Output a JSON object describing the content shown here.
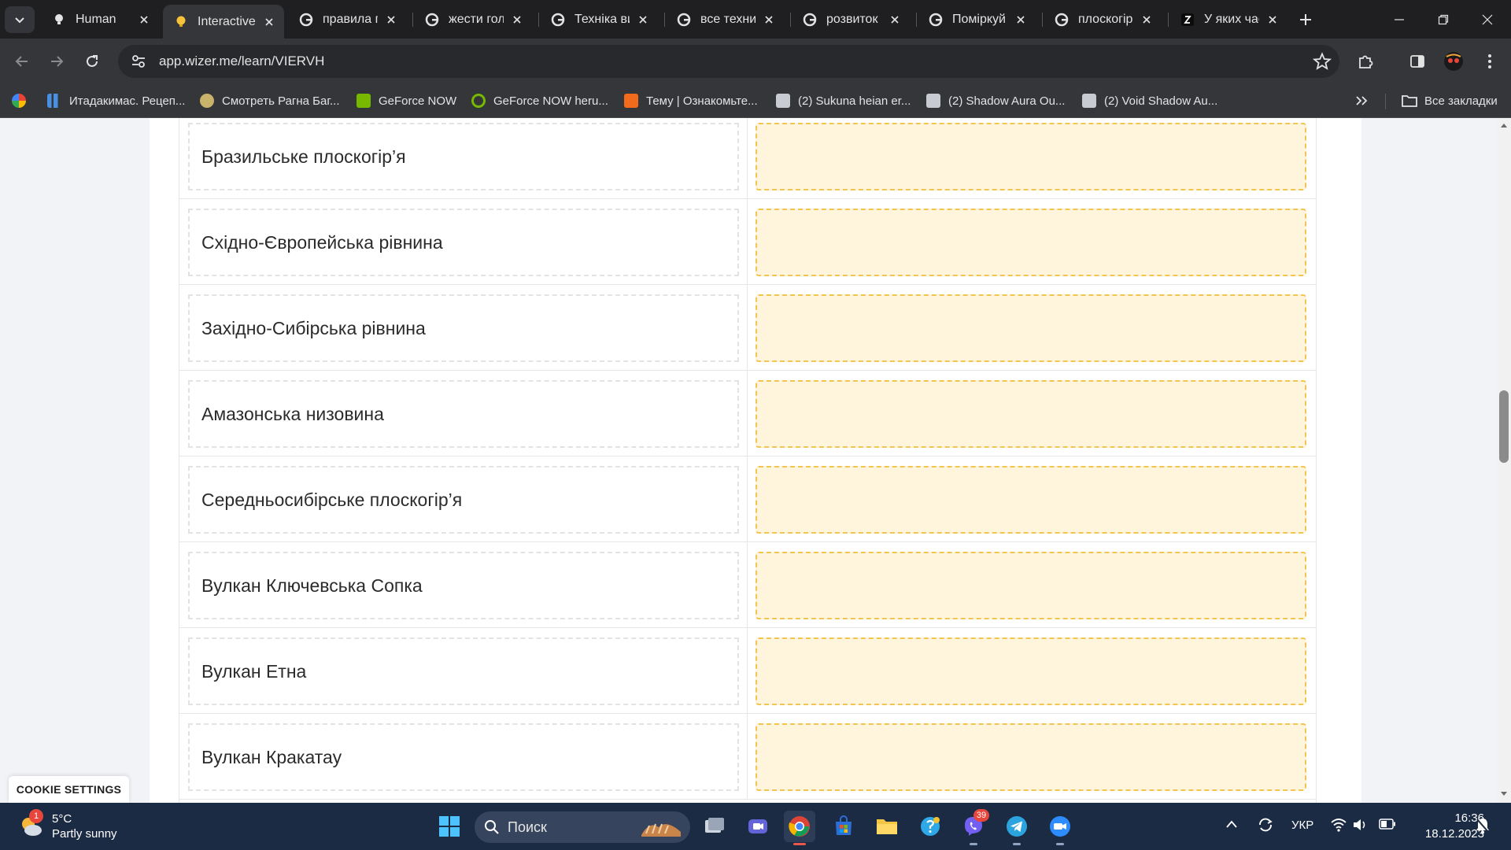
{
  "browser": {
    "tabs": [
      {
        "title": "Human",
        "active": false
      },
      {
        "title": "Interactive",
        "active": true
      },
      {
        "title": "правила г",
        "active": false
      },
      {
        "title": "жести гол",
        "active": false
      },
      {
        "title": "Техніка ви",
        "active": false
      },
      {
        "title": "все техни",
        "active": false
      },
      {
        "title": "розвиток",
        "active": false
      },
      {
        "title": "Поміркуй",
        "active": false
      },
      {
        "title": "плоскогір",
        "active": false
      },
      {
        "title": "У яких час",
        "active": false
      }
    ],
    "url": "app.wizer.me/learn/VIERVH",
    "bookmarks": [
      {
        "label": "Итадакимас. Рецеп..."
      },
      {
        "label": "Смотреть Рагна Баг..."
      },
      {
        "label": "GeForce NOW"
      },
      {
        "label": "GeForce NOW heru..."
      },
      {
        "label": "Тему | Ознакомьте..."
      },
      {
        "label": "(2) Sukuna heian er..."
      },
      {
        "label": "(2) Shadow Aura Ou..."
      },
      {
        "label": "(2) Void Shadow Au..."
      }
    ],
    "all_bookmarks": "Все закладки"
  },
  "matching": {
    "rows": [
      {
        "left": "Бразильське плоскогір’я",
        "right": ""
      },
      {
        "left": "Східно-Європейська рівнина",
        "right": ""
      },
      {
        "left": "Західно-Сибірська рівнина",
        "right": ""
      },
      {
        "left": "Амазонська низовина",
        "right": ""
      },
      {
        "left": "Середньосибірське плоскогір’я",
        "right": ""
      },
      {
        "left": "Вулкан Ключевська Сопка",
        "right": ""
      },
      {
        "left": "Вулкан Етна",
        "right": ""
      },
      {
        "left": "Вулкан Кракатау",
        "right": ""
      }
    ]
  },
  "cookie": {
    "label": "COOKIE SETTINGS"
  },
  "taskbar": {
    "weather": {
      "temp": "5°C",
      "desc": "Partly sunny",
      "badge": "1"
    },
    "search_placeholder": "Поиск",
    "viber_badge": "39",
    "lang": "УКР",
    "time": "16:36",
    "date": "18.12.2023"
  },
  "colors": {
    "dropzone_border": "#f2c452",
    "dropzone_fill": "#fff5dc",
    "card_border": "#e3e3e3"
  }
}
